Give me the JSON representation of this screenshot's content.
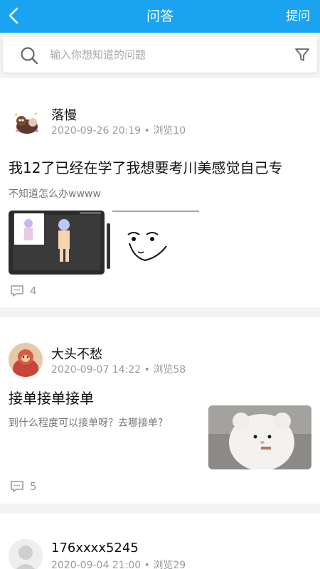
{
  "header": {
    "title": "问答",
    "ask_label": "提问"
  },
  "search": {
    "placeholder": "输入你想知道的问题"
  },
  "posts": [
    {
      "user": "落慢",
      "date": "2020-09-26 20:19",
      "views": "浏览10",
      "title": "我12了已经在学了我想要考川美感觉自己专",
      "desc": "不知道怎么办wwww",
      "comments": "4"
    },
    {
      "user": "大头不愁",
      "date": "2020-09-07 14:22",
      "views": "浏览58",
      "title": "接单接单接单",
      "desc": "到什么程度可以接单呀？去哪接单？",
      "comments": "5"
    },
    {
      "user": "176xxxx5245",
      "date": "2020-09-04 21:00",
      "views": "浏览29"
    }
  ],
  "colors": {
    "accent": "#1aa3f0",
    "background": "#f2f3f5"
  }
}
